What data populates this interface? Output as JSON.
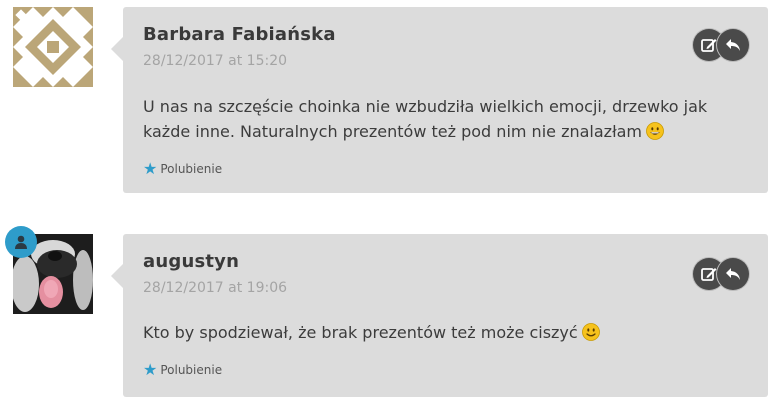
{
  "comments": [
    {
      "author": "Barbara Fabiańska",
      "date": "28/12/2017 at 15:20",
      "text": "U nas na szczęście choinka nie wzbudziła wielkich emocji, drzewko jak każde inne. Naturalnych prezentów też pod nim nie znalazłam",
      "emoji": "grinning-face-icon",
      "like_label": "Polubienie",
      "avatar": "identicon-tan-pattern"
    },
    {
      "author": "augustyn",
      "date": "28/12/2017 at 19:06",
      "text": "Kto by spodziewał, że brak prezentów też może ciszyć",
      "emoji": "smiling-face-icon",
      "like_label": "Polubienie",
      "avatar": "dog-photo"
    }
  ],
  "colors": {
    "bubble_bg": "#dcdcdc",
    "accent": "#2e9cca",
    "author": "#3a3a3a",
    "date": "#a4a4a4",
    "action_button": "#4a4a4a",
    "identicon": "#bba678"
  }
}
